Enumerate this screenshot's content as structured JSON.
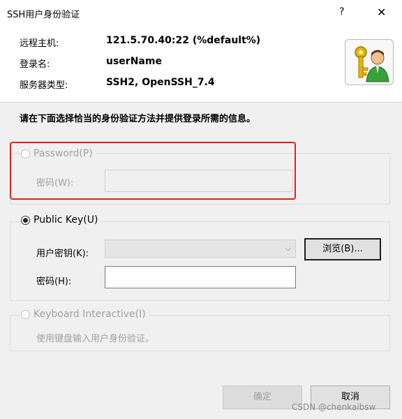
{
  "window": {
    "title": "SSH用户身份验证",
    "help_label": "?",
    "close_label": "✕"
  },
  "info": {
    "remote_host_label": "远程主机:",
    "remote_host_value": "121.5.70.40:22 (%default%)",
    "login_label": "登录名:",
    "login_value": "userName",
    "server_type_label": "服务器类型:",
    "server_type_value": "SSH2, OpenSSH_7.4",
    "avatar_icon": "key-user-icon"
  },
  "instruction": "请在下面选择恰当的身份验证方法并提供登录所需的信息。",
  "password_group": {
    "radio_label": "Password(P)",
    "checked": false,
    "enabled": false,
    "password_label": "密码(W):",
    "password_value": ""
  },
  "pubkey_group": {
    "radio_label": "Public Key(U)",
    "checked": true,
    "enabled": true,
    "user_key_label": "用户密钥(K):",
    "user_key_value": "",
    "browse_label": "浏览(B)...",
    "password_label": "密码(H):",
    "password_value": ""
  },
  "keyboard_group": {
    "radio_label": "Keyboard Interactive(I)",
    "checked": false,
    "enabled": false,
    "description": "使用键盘输入用户身份验证。"
  },
  "buttons": {
    "ok_label": "确定",
    "cancel_label": "取消"
  },
  "watermark": "CSDN @chenkaibsw",
  "colors": {
    "highlight": "#e0201e",
    "dialog_bg": "#f0f0f0"
  }
}
